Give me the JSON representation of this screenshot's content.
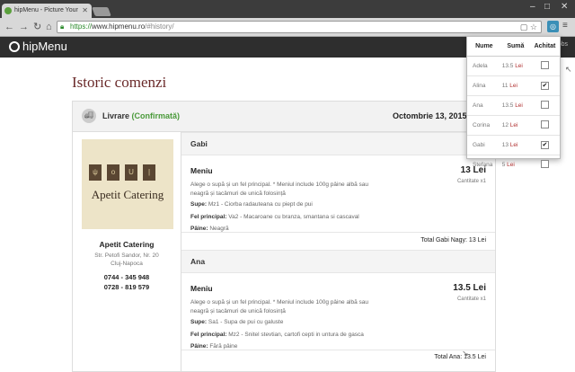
{
  "browser": {
    "tab_title": "hipMenu - Picture Your",
    "url_scheme": "https://",
    "url_host": "www.hipmenu.ro",
    "url_path": "/#history/"
  },
  "app": {
    "logo_text": "hipMenu",
    "header_right": "obs"
  },
  "page": {
    "title": "Istoric comenzi"
  },
  "order": {
    "delivery_label": "Livrare",
    "status": "(Confirmată)",
    "date": "Octombrie 13, 2015"
  },
  "restaurant": {
    "logo_text": "Apetit Catering",
    "name": "Apetit Catering",
    "address1": "Str. Petofi Sandor, Nr. 20",
    "address2": "Cluj-Napoca",
    "phone1": "0744 - 345 948",
    "phone2": "0728 - 819 579"
  },
  "people": [
    {
      "name": "Gabi",
      "item": "Meniu",
      "price": "13 Lei",
      "qty": "Cantitate x1",
      "desc": "Alege o supă și un fel principal. * Meniul include 100g pâine albă sau neagră și tacâmuri de unică folosință",
      "soup_label": "Supe:",
      "soup": "Mz1 - Ciorba radauteana cu piept de pui",
      "main_label": "Fel principal:",
      "main": "Va2 - Macaroane cu branza, smantana si cascaval",
      "bread_label": "Pâine:",
      "bread": "Neagră",
      "total": "Total Gabi Nagy: 13 Lei"
    },
    {
      "name": "Ana",
      "item": "Meniu",
      "price": "13.5 Lei",
      "qty": "Cantitate x1",
      "desc": "Alege o supă și un fel principal. * Meniul include 100g pâine albă sau neagră și tacâmuri de unică folosință",
      "soup_label": "Supe:",
      "soup": "Sa1 - Supa de pui cu galuste",
      "main_label": "Fel principal:",
      "main": "Mz2 - Snitel stevtian, cartofi cepti in untura de gasca",
      "bread_label": "Pâine:",
      "bread": "Fără pâine",
      "total": "Total Ana: 13.5 Lei"
    }
  ],
  "popup": {
    "headers": [
      "Nume",
      "Sumă",
      "Achitat"
    ],
    "rows": [
      {
        "name": "Adela",
        "amount": "13.5",
        "currency": "Lei",
        "paid": false
      },
      {
        "name": "Alina",
        "amount": "11",
        "currency": "Lei",
        "paid": true
      },
      {
        "name": "Ana",
        "amount": "13.5",
        "currency": "Lei",
        "paid": false
      },
      {
        "name": "Corina",
        "amount": "12",
        "currency": "Lei",
        "paid": false
      },
      {
        "name": "Gabi",
        "amount": "13",
        "currency": "Lei",
        "paid": true
      },
      {
        "name": "Stefana",
        "amount": "5",
        "currency": "Lei",
        "paid": false
      }
    ]
  }
}
